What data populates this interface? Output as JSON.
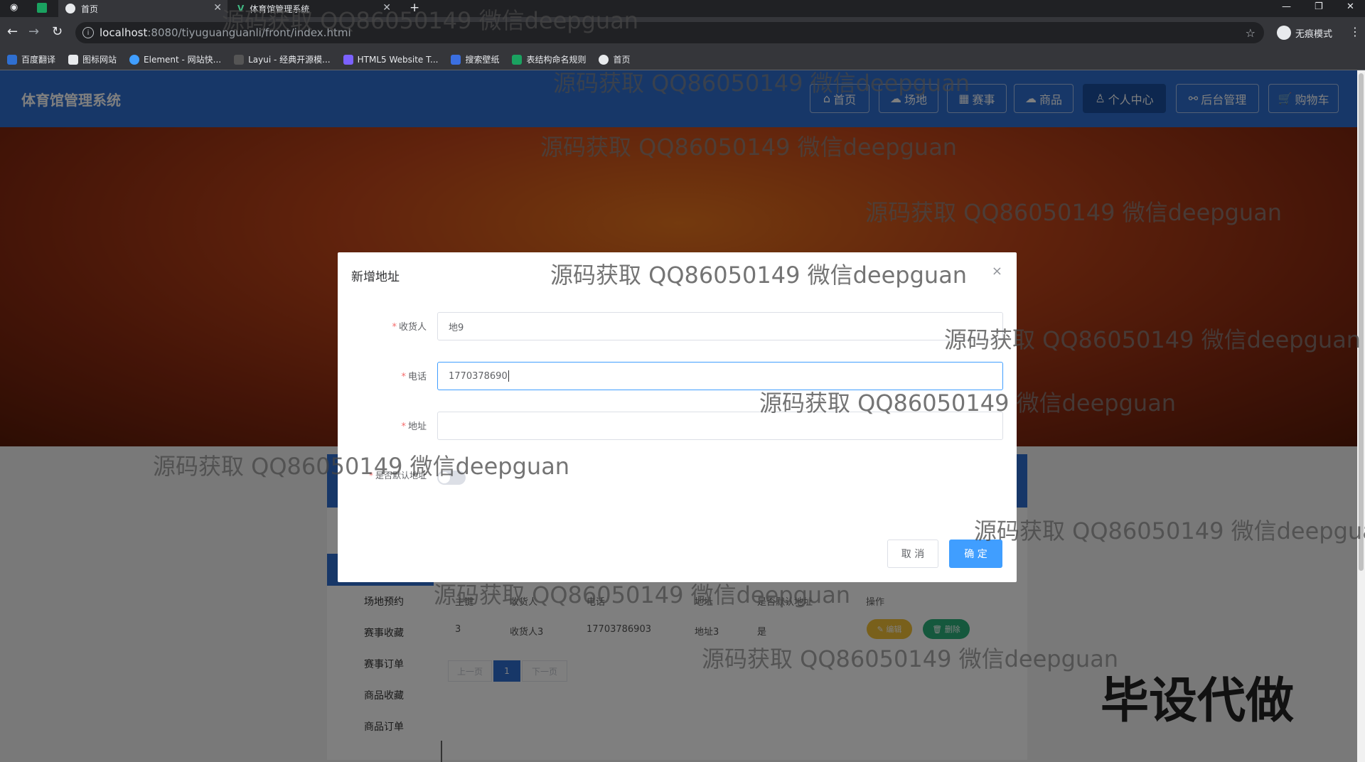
{
  "browser": {
    "tabs": [
      {
        "label": "首页",
        "active": true
      },
      {
        "label": "体育馆管理系统",
        "active": false
      }
    ],
    "new_tab": "+",
    "url_host": "localhost",
    "url_path": ":8080/tiyuguanguanli/front/index.html",
    "profile_label": "无痕模式",
    "bookmarks": [
      "百度翻译",
      "图标网站",
      "Element - 网站快...",
      "Layui - 经典开源模...",
      "HTML5 Website T...",
      "搜索壁纸",
      "表结构命名规则",
      "首页"
    ]
  },
  "site": {
    "title": "体育馆管理系统",
    "nav": [
      {
        "label": "首页",
        "icon": "home-icon"
      },
      {
        "label": "场地",
        "icon": "cloud-icon"
      },
      {
        "label": "赛事",
        "icon": "calendar-icon"
      },
      {
        "label": "商品",
        "icon": "cloud-icon"
      },
      {
        "label": "个人中心",
        "icon": "user-icon",
        "active": true
      },
      {
        "label": "后台管理",
        "icon": "link-icon"
      },
      {
        "label": "购物车",
        "icon": "cart-icon"
      }
    ]
  },
  "background_page": {
    "side_menu": [
      "场地预约",
      "赛事收藏",
      "赛事订单",
      "商品收藏",
      "商品订单"
    ],
    "table_headers": [
      "主键",
      "收货人",
      "电话",
      "地址",
      "是否默认地址",
      "操作"
    ],
    "row": {
      "id": "3",
      "receiver": "收货人3",
      "phone": "17703786903",
      "address": "地址3",
      "is_default": "是"
    },
    "edit_label": "✎ 编辑",
    "delete_label": "🗑 删除",
    "pager": {
      "prev": "上一页",
      "current": "1",
      "next": "下一页"
    }
  },
  "dialog": {
    "title": "新增地址",
    "close": "×",
    "fields": [
      {
        "label": "收货人",
        "value": "地9",
        "required": true
      },
      {
        "label": "电话",
        "value": "1770378690",
        "required": true,
        "focused": true
      },
      {
        "label": "地址",
        "value": "",
        "required": true
      }
    ],
    "default_label": "是否默认地址",
    "default_required": true,
    "default_on": false,
    "cancel_label": "取 消",
    "ok_label": "确 定"
  },
  "watermark_text": "源码获取 QQ86050149 微信deepguan",
  "stamp_text": "毕设代做",
  "colors": {
    "primary": "#2f6fd0",
    "element_blue": "#409eff",
    "danger": "#f56c6c"
  }
}
